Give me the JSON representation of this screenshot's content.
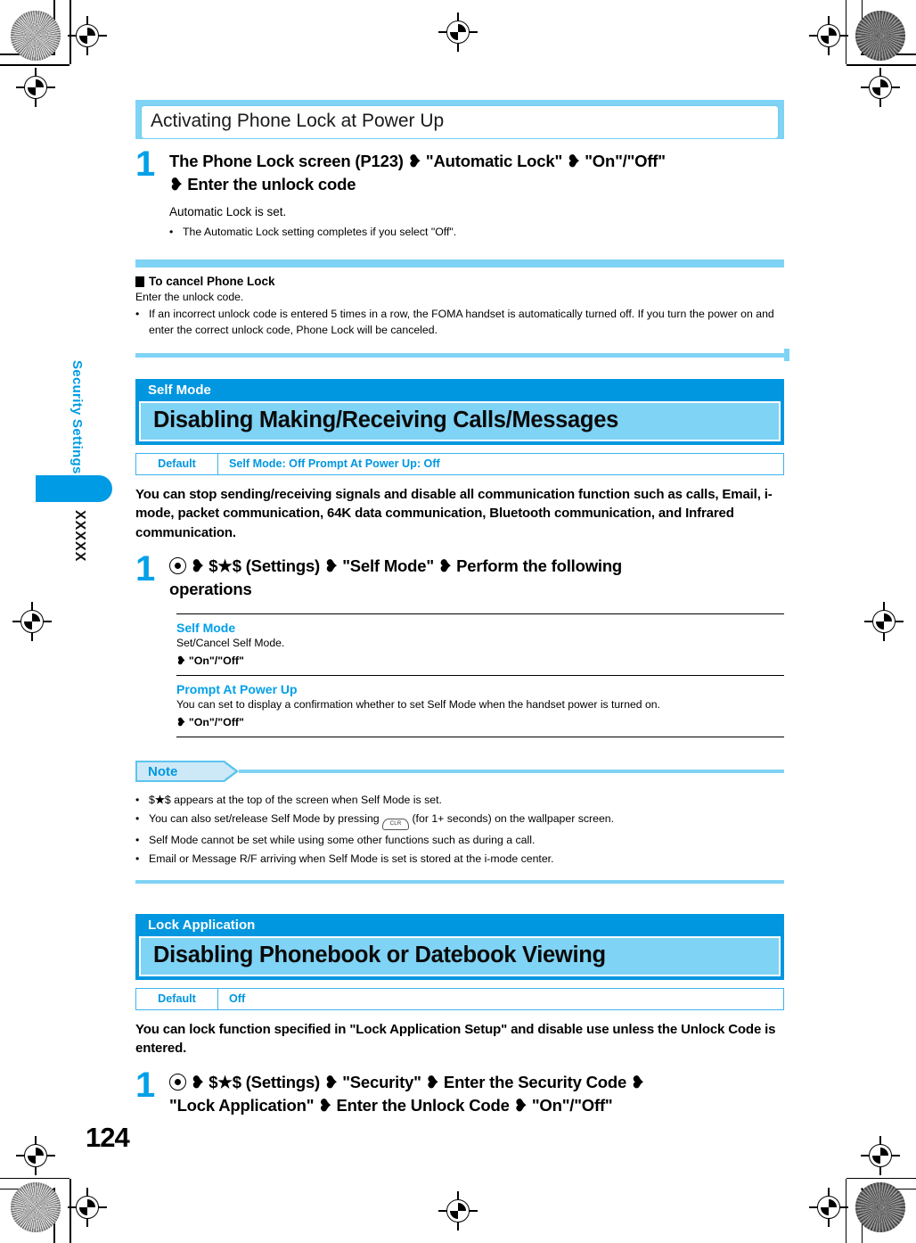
{
  "page": {
    "number": "124",
    "chapter_label": "Security Settings",
    "tab_number": "XXXXX"
  },
  "phone_lock": {
    "title": "Activating Phone Lock at Power Up",
    "step_number": "1",
    "step_head_line1": "The Phone Lock screen (P123) ❥ \"Automatic Lock\" ❥ \"On\"/\"Off\"",
    "step_head_line2": "❥ Enter the unlock code",
    "step_sub": "Automatic Lock is set.",
    "bullets": [
      "The Automatic Lock setting completes if you select \"Off\"."
    ],
    "cancel": {
      "title": "To cancel Phone Lock",
      "text": "Enter the unlock code.",
      "bullets": [
        "If an incorrect unlock code is entered 5 times in a row, the FOMA handset is automatically turned off. If you turn the power on and enter the correct unlock code, Phone Lock will be canceled."
      ]
    }
  },
  "self_mode": {
    "kicker": "Self Mode",
    "title": "Disabling Making/Receiving Calls/Messages",
    "default_label": "Default",
    "default_value": "Self Mode:  Off    Prompt At Power Up:  Off",
    "paragraph": "You can stop sending/receiving signals and disable all communication function such as calls, Email, i-mode, packet communication, 64K data communication, Bluetooth communication, and Infrared communication.",
    "step_number": "1",
    "step_head_line1_a": "❥ $",
    "step_head_line1_b": "$ (Settings) ❥ \"Self Mode\" ❥ Perform the following",
    "step_head_line2": "operations",
    "options": [
      {
        "name": "Self Mode",
        "desc": "Set/Cancel Self Mode.",
        "choice": "❥ \"On\"/\"Off\""
      },
      {
        "name": "Prompt At Power Up",
        "desc": "You can set to display a confirmation whether to set Self Mode when the handset power is turned on.",
        "choice": "❥ \"On\"/\"Off\""
      }
    ],
    "note": {
      "label": "Note",
      "bullets": [
        {
          "pre": "$",
          "mid": "$",
          "post": " appears at the top of the screen when Self Mode is set."
        },
        {
          "pre": "You can also set/release Self Mode by pressing ",
          "key": "CLR",
          "post": " (for 1+ seconds) on the wallpaper screen."
        },
        {
          "pre": "Self Mode cannot be set while using some other functions such as during a call.",
          "post": ""
        },
        {
          "pre": "Email or Message R/F arriving when Self Mode is set is stored at the i-mode center.",
          "post": ""
        }
      ]
    }
  },
  "lock_application": {
    "kicker": "Lock Application",
    "title": "Disabling Phonebook or Datebook Viewing",
    "default_label": "Default",
    "default_value": "Off",
    "paragraph": "You can lock function specified in \"Lock Application Setup\" and disable use unless the Unlock Code is entered.",
    "step_number": "1",
    "step_head_line1_a": "❥ $",
    "step_head_line1_b": "$ (Settings) ❥ \"Security\" ❥ Enter the Security Code ❥",
    "step_head_line2": "\"Lock Application\" ❥ Enter the Unlock Code ❥ \"On\"/\"Off\""
  },
  "symbols": {
    "star": "★",
    "bullet_dot": "•"
  },
  "colors": {
    "accent_blue": "#0096E0",
    "light_blue": "#7FD3F5",
    "step_blue": "#00A0E9"
  }
}
